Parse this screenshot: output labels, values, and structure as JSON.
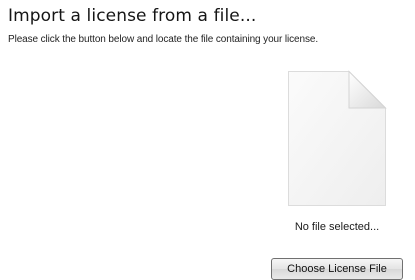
{
  "heading": "Import a license from a file...",
  "instruction": "Please click the button below and locate the file containing your license.",
  "file": {
    "icon": "blank-document-icon",
    "status": "No file selected..."
  },
  "choose_button_label": "Choose License File"
}
